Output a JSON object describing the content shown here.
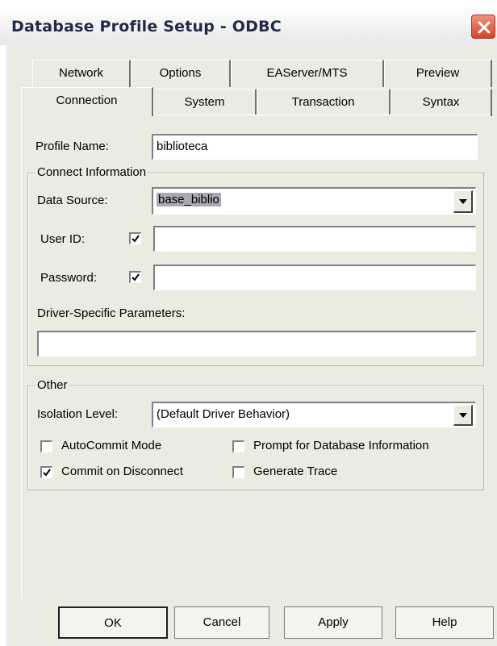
{
  "window": {
    "title": "Database Profile Setup - ODBC"
  },
  "tabs_top": [
    "Network",
    "Options",
    "EAServer/MTS",
    "Preview"
  ],
  "tabs_bottom": [
    "Connection",
    "System",
    "Transaction",
    "Syntax"
  ],
  "active_tab": "Connection",
  "profile": {
    "label": "Profile Name:",
    "value": "biblioteca"
  },
  "connect": {
    "legend": "Connect Information",
    "data_source_label": "Data Source:",
    "data_source_value": "base_biblio",
    "userid_label": "User ID:",
    "userid_checked": true,
    "userid_value": "",
    "password_label": "Password:",
    "password_checked": true,
    "password_value": "",
    "driver_label": "Driver-Specific Parameters:",
    "driver_value": ""
  },
  "other": {
    "legend": "Other",
    "isolation_label": "Isolation Level:",
    "isolation_value": "(Default Driver Behavior)",
    "autocommit_label": "AutoCommit Mode",
    "autocommit_checked": false,
    "prompt_label": "Prompt for Database Information",
    "prompt_checked": false,
    "commit_label": "Commit on Disconnect",
    "commit_checked": true,
    "trace_label": "Generate Trace",
    "trace_checked": false
  },
  "buttons": {
    "ok": "OK",
    "cancel": "Cancel",
    "apply": "Apply",
    "help": "Help"
  },
  "colors": {
    "dialog_bg": "#ecebe2",
    "close_button": "#d4452a",
    "selection": "#a9a8b6"
  }
}
